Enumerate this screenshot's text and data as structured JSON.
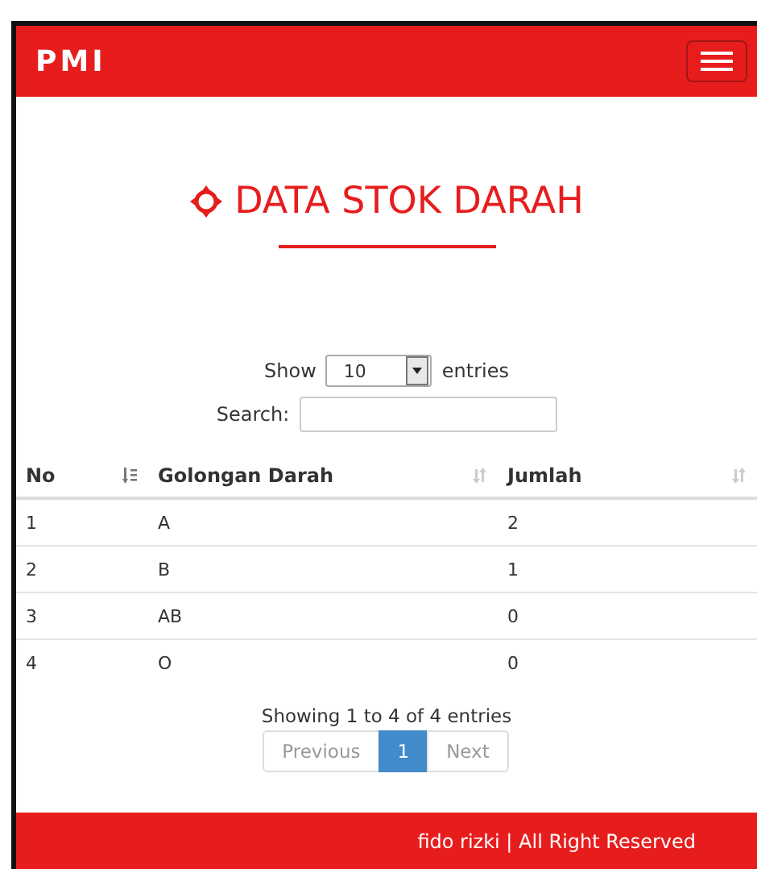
{
  "navbar": {
    "brand": "PMI"
  },
  "heading": {
    "title": "DATA STOK DARAH"
  },
  "length_control": {
    "prefix": "Show",
    "value": "10",
    "suffix": "entries"
  },
  "search": {
    "label": "Search:"
  },
  "table": {
    "columns": [
      {
        "label": "No",
        "sorted": true
      },
      {
        "label": "Golongan Darah",
        "sorted": false
      },
      {
        "label": "Jumlah",
        "sorted": false
      }
    ],
    "rows": [
      [
        "1",
        "A",
        "2"
      ],
      [
        "2",
        "B",
        "1"
      ],
      [
        "3",
        "AB",
        "0"
      ],
      [
        "4",
        "O",
        "0"
      ]
    ]
  },
  "info": "Showing 1 to 4 of 4 entries",
  "pagination": {
    "previous": {
      "label": "Previous",
      "disabled": true
    },
    "pages": [
      {
        "label": "1",
        "selected": true
      }
    ],
    "next": {
      "label": "Next",
      "disabled": true
    }
  },
  "footer": {
    "text": "fido rizki | All Right Reserved"
  }
}
